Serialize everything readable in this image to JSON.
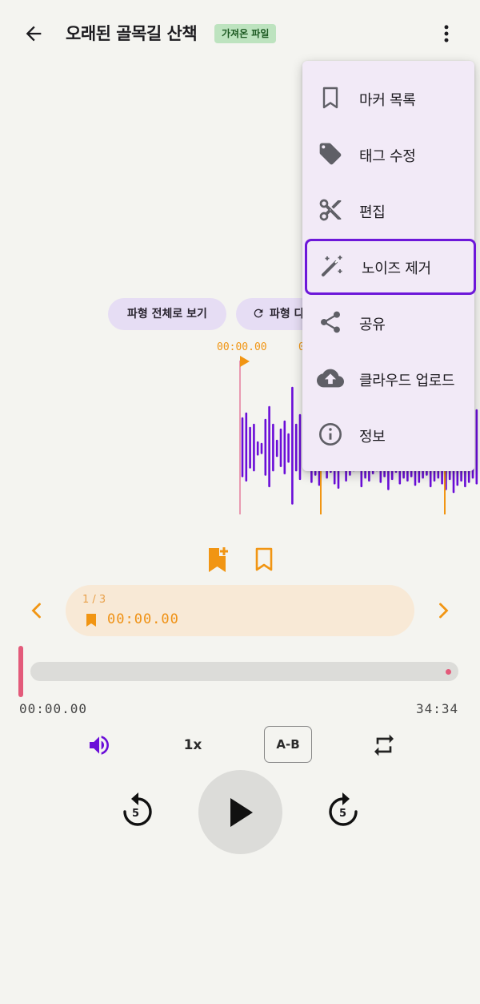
{
  "header": {
    "title": "오래된 골목길 산책",
    "badge": "가져온 파일",
    "back_icon": "arrow-left-icon",
    "more_icon": "more-vert-icon"
  },
  "waveform": {
    "view_all_label": "파형 전체로 보기",
    "regenerate_label": "파형 다시",
    "time_labels": [
      "00:00.00",
      "0"
    ]
  },
  "markers": {
    "count": "1 / 3",
    "time": "00:00.00"
  },
  "playback": {
    "current_time": "00:00.00",
    "total_time": "34:34",
    "progress": 0,
    "speed": "1x",
    "ab_label": "A-B",
    "rewind_seconds": "5",
    "forward_seconds": "5"
  },
  "menu": {
    "items": [
      {
        "label": "마커 목록",
        "icon": "bookmark-icon"
      },
      {
        "label": "태그 수정",
        "icon": "tag-icon"
      },
      {
        "label": "편집",
        "icon": "scissors-icon"
      },
      {
        "label": "노이즈 제거",
        "icon": "magic-wand-icon"
      },
      {
        "label": "공유",
        "icon": "share-icon"
      },
      {
        "label": "클라우드 업로드",
        "icon": "cloud-upload-icon"
      },
      {
        "label": "정보",
        "icon": "info-icon"
      }
    ],
    "selected_index": 3
  },
  "colors": {
    "accent": "#6d18d9",
    "waveform": "#6a0dd8",
    "marker": "#f19513",
    "playhead": "#e35a7a"
  }
}
